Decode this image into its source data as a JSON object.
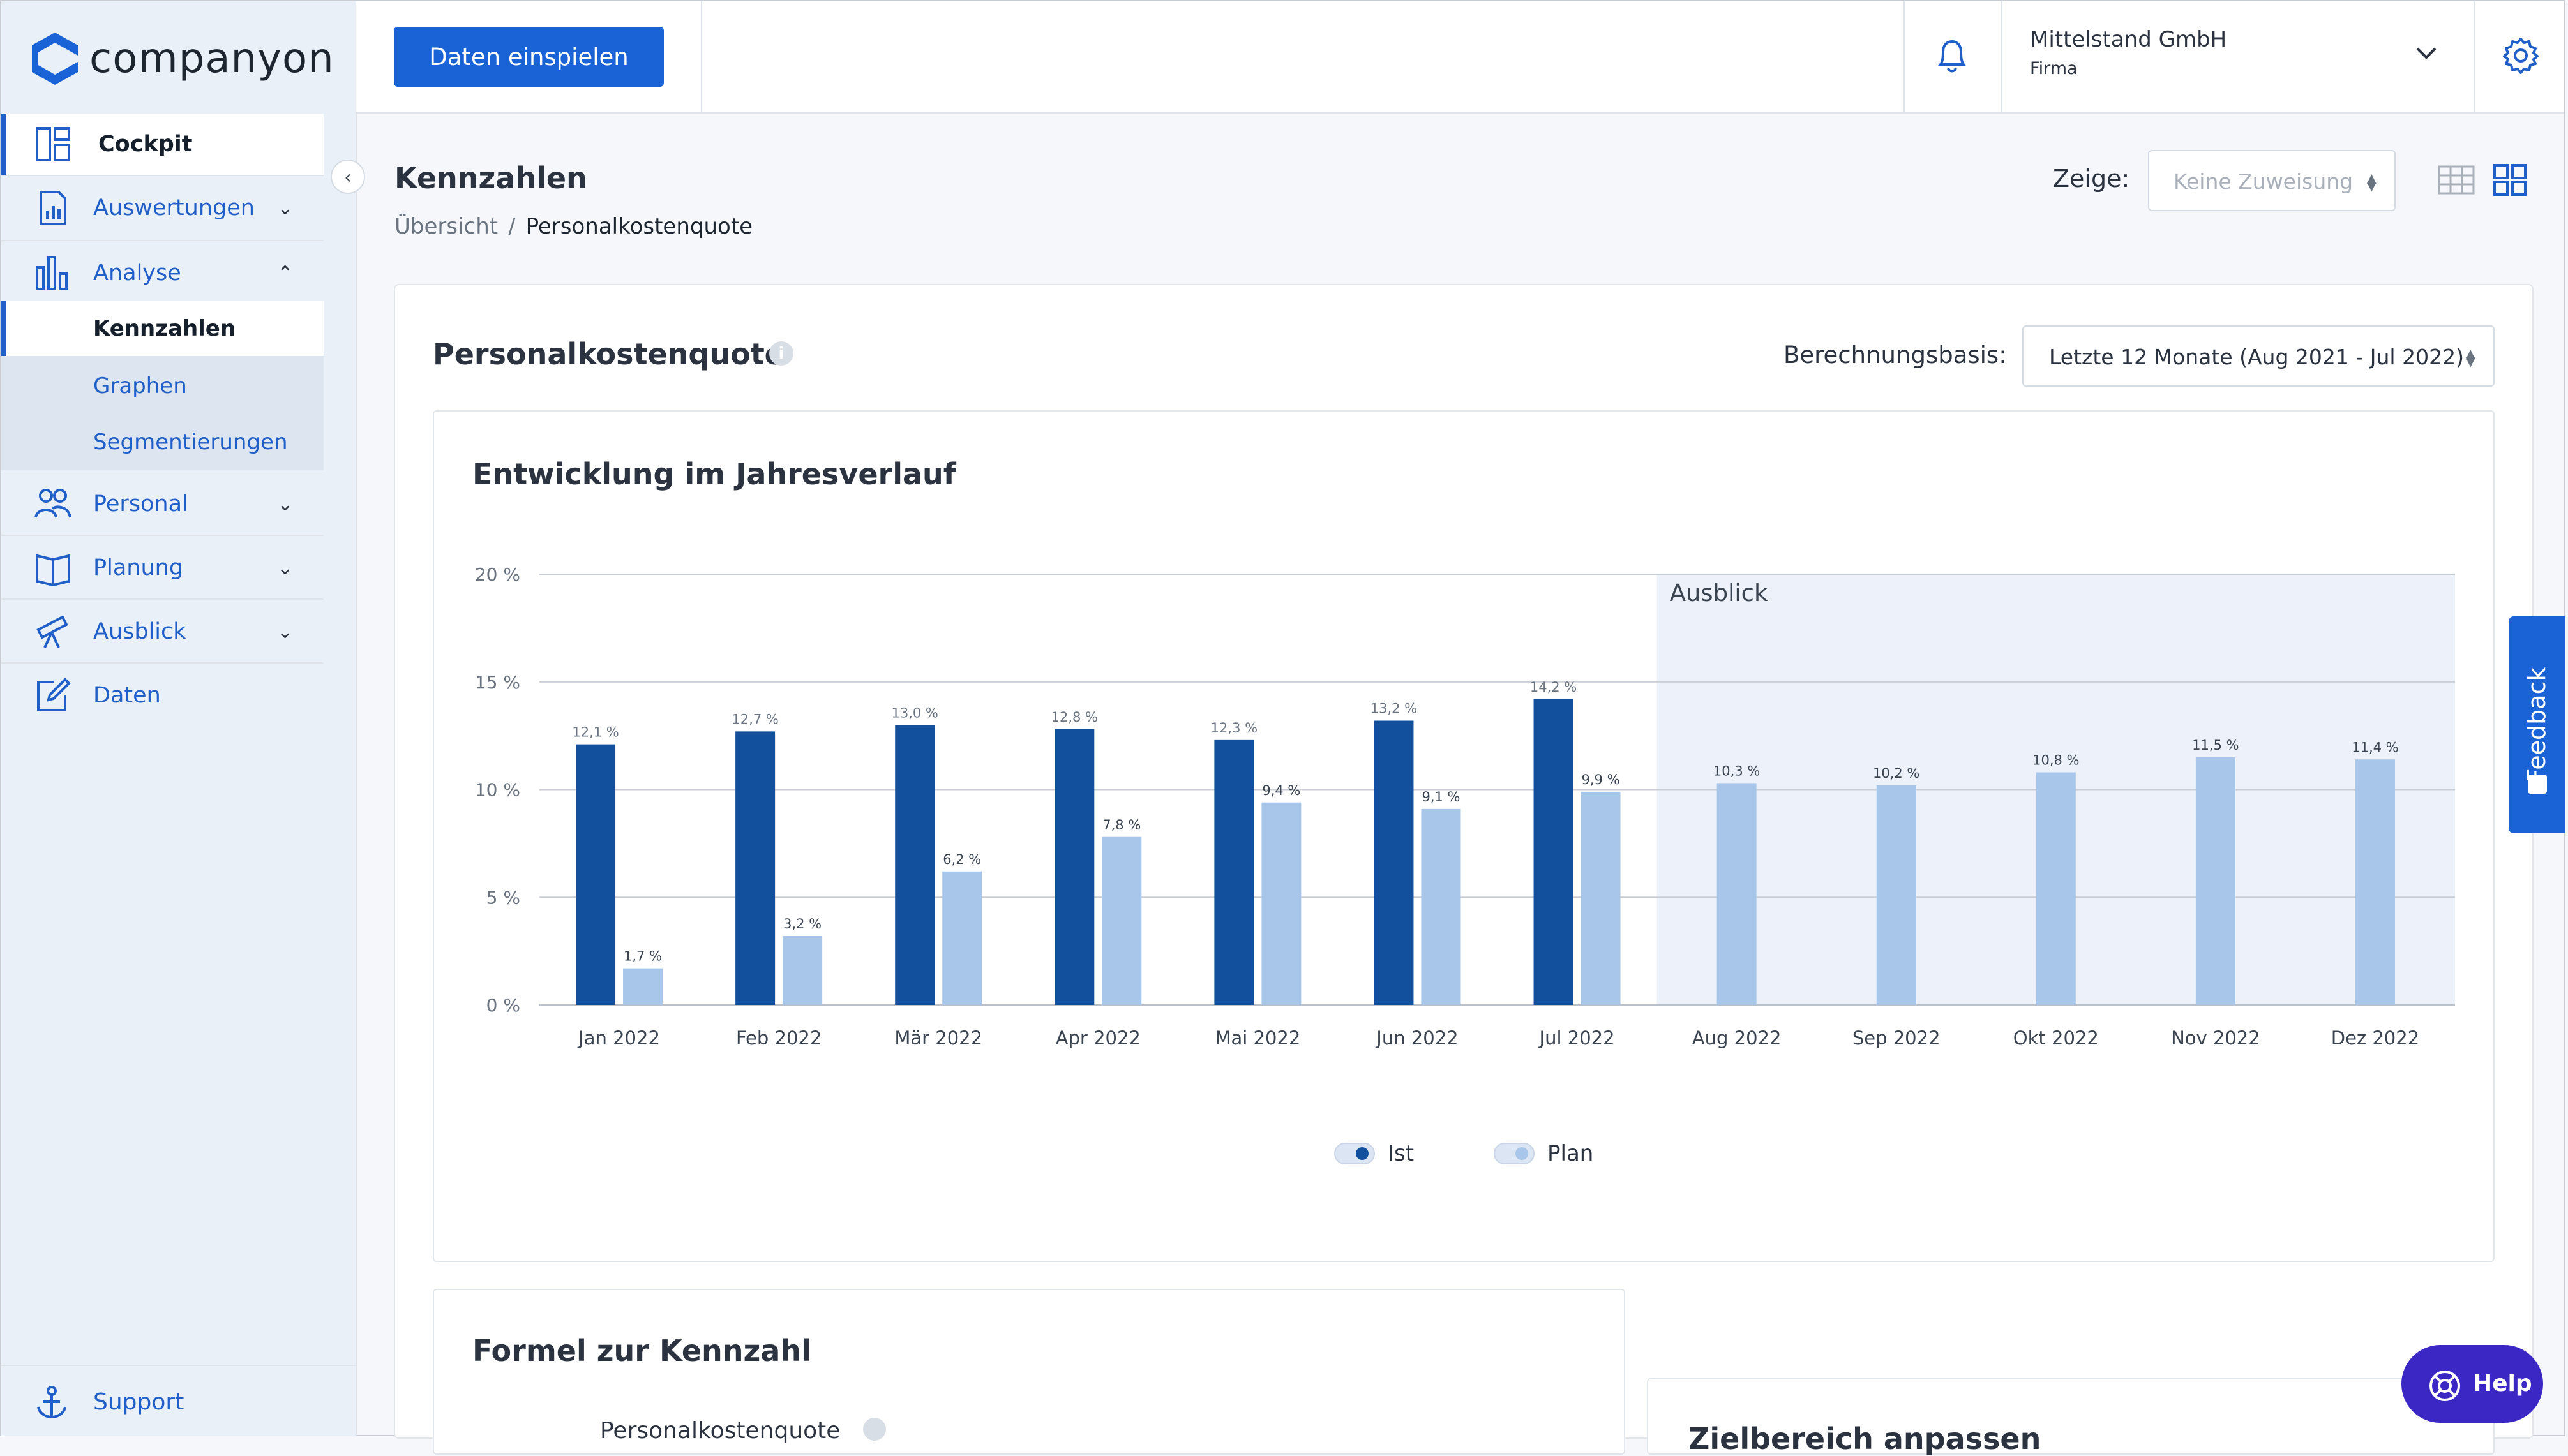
{
  "app": {
    "logo_text": "companyon",
    "brand_color": "#1a63d6"
  },
  "header": {
    "import_button": "Daten einspielen",
    "company_name": "Mittelstand GmbH",
    "company_type": "Firma"
  },
  "sidebar": {
    "items": [
      {
        "label": "Cockpit",
        "icon": "dashboard-icon"
      },
      {
        "label": "Auswertungen",
        "icon": "report-icon"
      },
      {
        "label": "Analyse",
        "icon": "bar-chart-icon"
      },
      {
        "label": "Personal",
        "icon": "people-icon"
      },
      {
        "label": "Planung",
        "icon": "book-icon"
      },
      {
        "label": "Ausblick",
        "icon": "telescope-icon"
      },
      {
        "label": "Daten",
        "icon": "edit-icon"
      }
    ],
    "analyse_sub": [
      {
        "label": "Kennzahlen"
      },
      {
        "label": "Graphen"
      },
      {
        "label": "Segmentierungen"
      }
    ],
    "support": "Support"
  },
  "page": {
    "title": "Kennzahlen",
    "breadcrumb": {
      "root": "Übersicht",
      "current": "Personalkostenquote"
    },
    "show_label": "Zeige:",
    "show_value": "Keine Zuweisung"
  },
  "card": {
    "title": "Personalkostenquote",
    "basis_label": "Berechnungsbasis:",
    "basis_value": "Letzte 12 Monate (Aug 2021 - Jul 2022)",
    "chart_title": "Entwicklung im Jahresverlauf",
    "formula_title": "Formel zur Kennzahl",
    "formula_sub": "Personalkostenquote",
    "target_title": "Zielbereich anpassen"
  },
  "chart_data": {
    "type": "bar",
    "categories": [
      "Jan 2022",
      "Feb 2022",
      "Mär 2022",
      "Apr 2022",
      "Mai 2022",
      "Jun 2022",
      "Jul 2022",
      "Aug 2022",
      "Sep 2022",
      "Okt 2022",
      "Nov 2022",
      "Dez 2022"
    ],
    "series": [
      {
        "name": "Ist",
        "color": "#12509e",
        "values": [
          12.1,
          12.7,
          13.0,
          12.8,
          12.3,
          13.2,
          14.2,
          null,
          null,
          null,
          null,
          null
        ],
        "labels": [
          "12,1 %",
          "12,7 %",
          "13,0 %",
          "12,8 %",
          "12,3 %",
          "13,2 %",
          "14,2 %",
          "",
          "",
          "",
          "",
          ""
        ]
      },
      {
        "name": "Plan",
        "color": "#a8c6ea",
        "values": [
          1.7,
          3.2,
          6.2,
          7.8,
          9.4,
          9.1,
          9.9,
          10.3,
          10.2,
          10.8,
          11.5,
          11.4
        ],
        "labels": [
          "1,7 %",
          "3,2 %",
          "6,2 %",
          "7,8 %",
          "9,4 %",
          "9,1 %",
          "9,9 %",
          "10,3 %",
          "10,2 %",
          "10,8 %",
          "11,5 %",
          "11,4 %"
        ]
      }
    ],
    "yticks": [
      "0 %",
      "5 %",
      "10 %",
      "15 %",
      "20 %"
    ],
    "ylim": [
      0,
      20
    ],
    "outlook_label": "Ausblick",
    "outlook_start_index": 7,
    "outlook_color": "#edf2fa",
    "grid": true,
    "legend_position": "bottom-center"
  },
  "feedback_label": "Feedback",
  "help_label": "Help"
}
